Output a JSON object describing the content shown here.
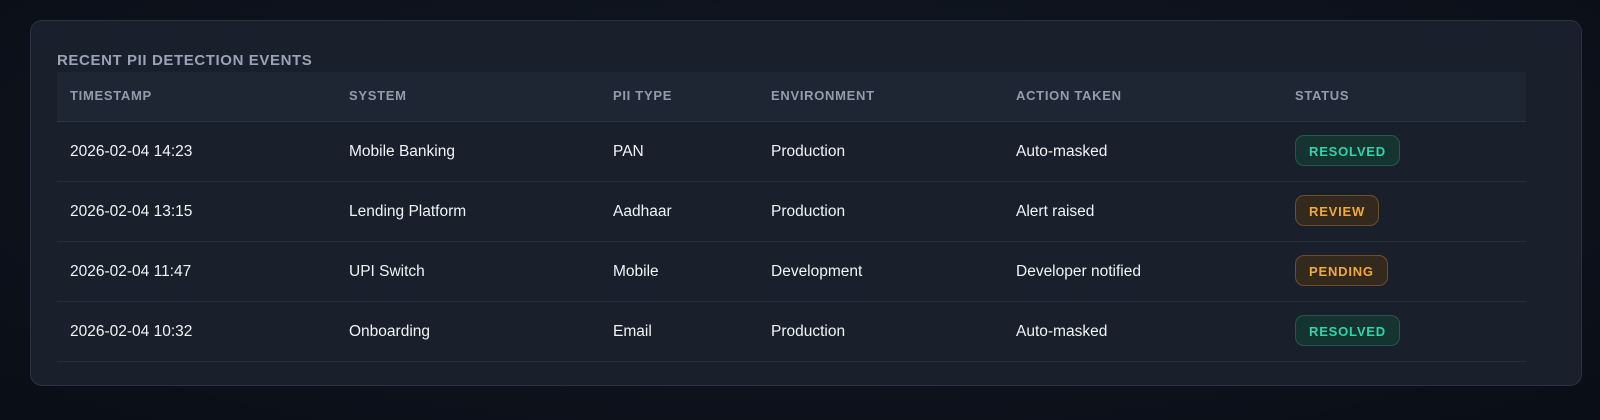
{
  "panel": {
    "title": "RECENT PII DETECTION EVENTS"
  },
  "table": {
    "columns": [
      "TIMESTAMP",
      "SYSTEM",
      "PII TYPE",
      "ENVIRONMENT",
      "ACTION TAKEN",
      "STATUS"
    ],
    "rows": [
      {
        "timestamp": "2026-02-04 14:23",
        "system": "Mobile Banking",
        "pii_type": "PAN",
        "environment": "Production",
        "action": "Auto-masked",
        "status": "RESOLVED"
      },
      {
        "timestamp": "2026-02-04 13:15",
        "system": "Lending Platform",
        "pii_type": "Aadhaar",
        "environment": "Production",
        "action": "Alert raised",
        "status": "REVIEW"
      },
      {
        "timestamp": "2026-02-04 11:47",
        "system": "UPI Switch",
        "pii_type": "Mobile",
        "environment": "Development",
        "action": "Developer notified",
        "status": "PENDING"
      },
      {
        "timestamp": "2026-02-04 10:32",
        "system": "Onboarding",
        "pii_type": "Email",
        "environment": "Production",
        "action": "Auto-masked",
        "status": "RESOLVED"
      }
    ]
  },
  "colors": {
    "resolved": "#2ed6aa",
    "review": "#f2a93a",
    "pending": "#f2a93a"
  }
}
